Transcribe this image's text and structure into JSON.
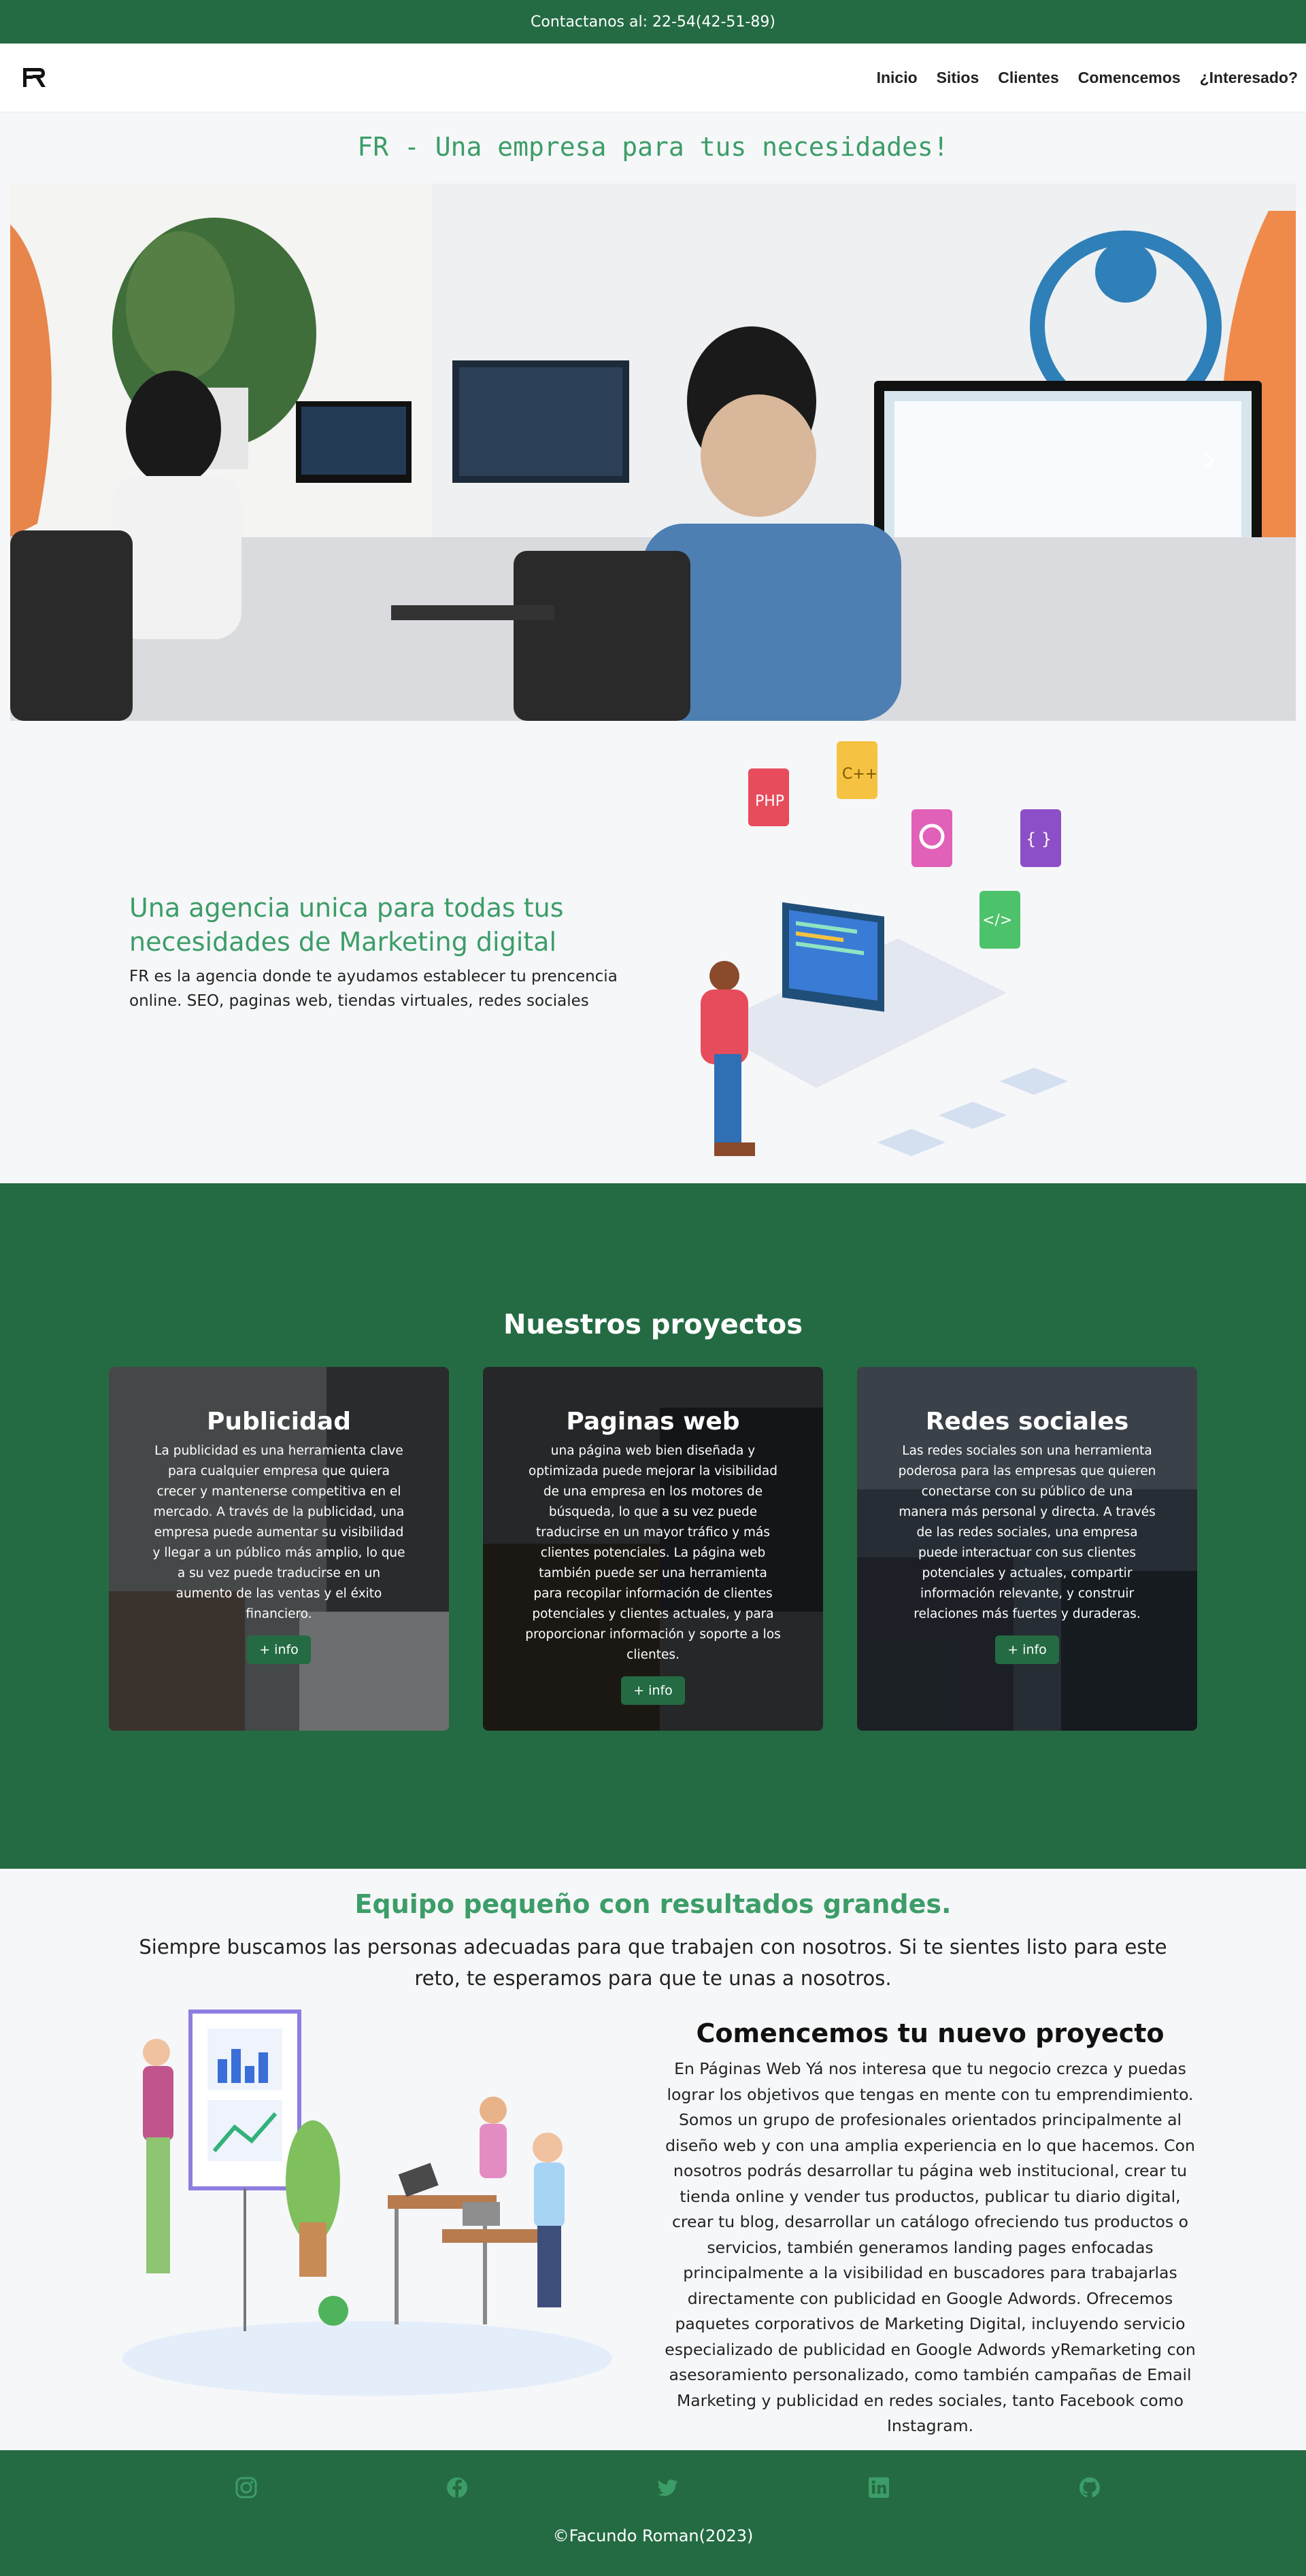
{
  "topbar": {
    "contact": "Contactanos al: 22-54(42-51-89)"
  },
  "nav": {
    "logo_icon": "fr-logo-icon",
    "items": [
      "Inicio",
      "Sitios",
      "Clientes",
      "Comencemos",
      "¿Interesado?"
    ]
  },
  "hero": {
    "title": "FR - Una empresa para tus necesidades!",
    "next_icon": "chevron-right-icon"
  },
  "agency": {
    "title": "Una agencia unica para todas tus necesidades de Marketing digital",
    "description": "FR es la agencia donde te ayudamos establecer tu prencencia online. SEO, paginas web, tiendas virtuales, redes sociales",
    "badges": [
      "C++",
      "PHP",
      "{ }",
      "</>"
    ]
  },
  "projects": {
    "title": "Nuestros proyectos",
    "cards": [
      {
        "title": "Publicidad",
        "description": "La publicidad es una herramienta clave para cualquier empresa que quiera crecer y mantenerse competitiva en el mercado. A través de la publicidad, una empresa puede aumentar su visibilidad y llegar a un público más amplio, lo que a su vez puede traducirse en un aumento de las ventas y el éxito financiero.",
        "button": "+ info"
      },
      {
        "title": "Paginas web",
        "description": "una página web bien diseñada y optimizada puede mejorar la visibilidad de una empresa en los motores de búsqueda, lo que a su vez puede traducirse en un mayor tráfico y más clientes potenciales. La página web también puede ser una herramienta para recopilar información de clientes potenciales y clientes actuales, y para proporcionar información y soporte a los clientes.",
        "button": "+ info"
      },
      {
        "title": "Redes sociales",
        "description": "Las redes sociales son una herramienta poderosa para las empresas que quieren conectarse con su público de una manera más personal y directa. A través de las redes sociales, una empresa puede interactuar con sus clientes potenciales y actuales, compartir información relevante, y construir relaciones más fuertes y duraderas.",
        "button": "+ info"
      }
    ]
  },
  "team": {
    "title": "Equipo pequeño con resultados grandes.",
    "description": "Siempre buscamos las personas adecuadas para que trabajen con nosotros. Si te sientes listo para este reto, te esperamos para que te unas a nosotros.",
    "new_project_title": "Comencemos tu nuevo proyecto",
    "new_project_text": "En Páginas Web Yá nos interesa que tu negocio crezca y puedas lograr los objetivos que tengas en mente con tu emprendimiento. Somos un grupo de profesionales orientados principalmente al diseño web y con una amplia experiencia en lo que hacemos. Con nosotros podrás desarrollar tu página web institucional, crear tu tienda online y vender tus productos, publicar tu diario digital, crear tu blog, desarrollar un catálogo ofreciendo tus productos o servicios, también generamos landing pages enfocadas principalmente a la visibilidad en buscadores para trabajarlas directamente con publicidad en Google Adwords. Ofrecemos paquetes corporativos de Marketing Digital, incluyendo servicio especializado de publicidad en Google Adwords yRemarketing con asesoramiento personalizado, como también campañas de Email Marketing y publicidad en redes sociales, tanto Facebook como Instagram."
  },
  "footer": {
    "socials": [
      "instagram-icon",
      "facebook-icon",
      "twitter-icon",
      "linkedin-icon",
      "github-icon"
    ],
    "copyright": "©Facundo Roman(2023)"
  },
  "colors": {
    "brand_green": "#246b43",
    "accent_green": "#3c9d68"
  }
}
